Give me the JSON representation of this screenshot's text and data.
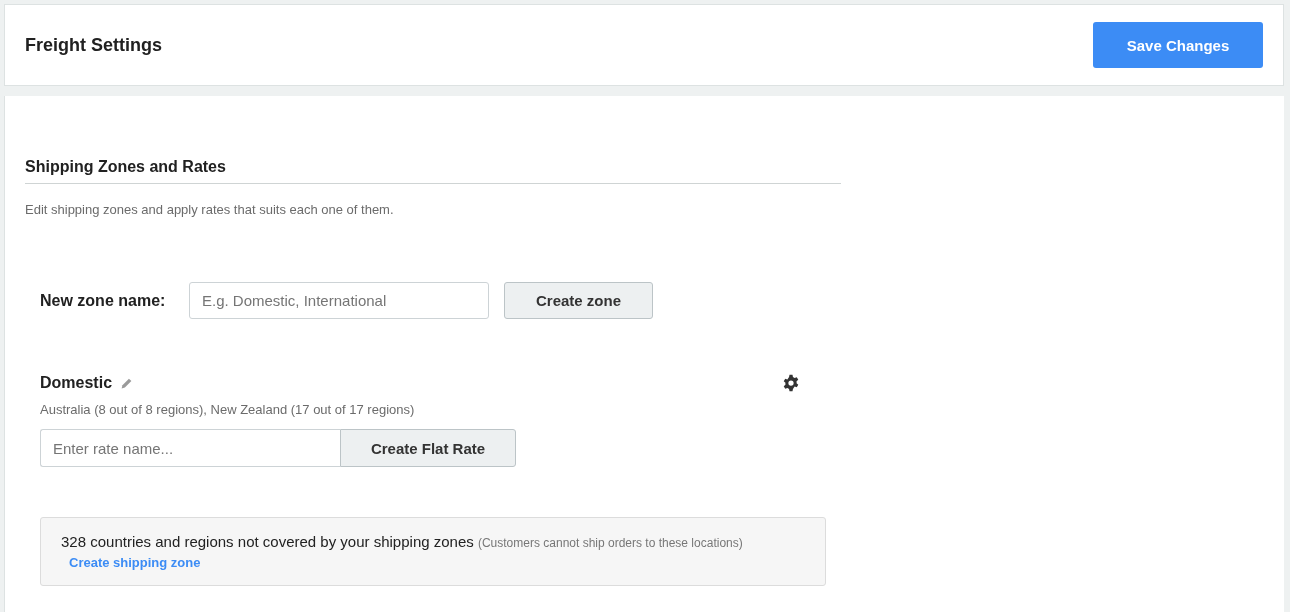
{
  "header": {
    "title": "Freight Settings",
    "save_button": "Save Changes"
  },
  "section": {
    "title": "Shipping Zones and Rates",
    "description": "Edit shipping zones and apply rates that suits each one of them."
  },
  "new_zone": {
    "label": "New zone name:",
    "placeholder": "E.g. Domestic, International",
    "button": "Create zone"
  },
  "zones": [
    {
      "name": "Domestic",
      "regions": "Australia (8 out of 8 regions), New Zealand (17 out of 17 regions)",
      "rate_placeholder": "Enter rate name...",
      "rate_button": "Create Flat Rate"
    }
  ],
  "notice": {
    "message": "328 countries and regions not covered by your shipping zones",
    "note": "(Customers cannot ship orders to these locations)",
    "link": "Create shipping zone"
  }
}
